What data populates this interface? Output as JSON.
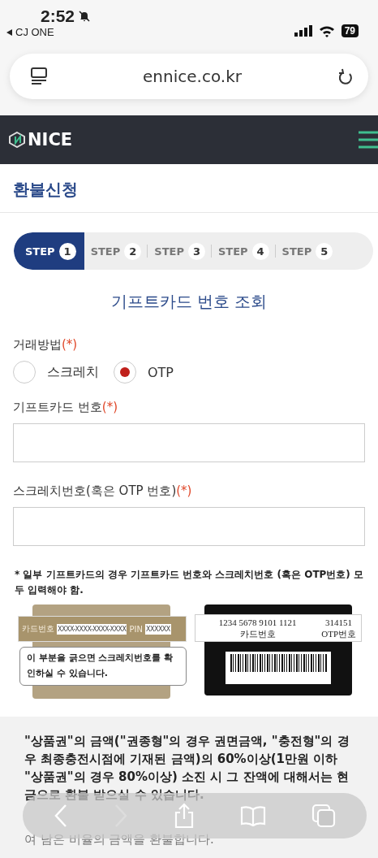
{
  "status_bar": {
    "time": "2:52",
    "back_app": "CJ ONE",
    "battery": "79"
  },
  "address_bar": {
    "url": "ennice.co.kr"
  },
  "site_header": {
    "logo": "NICE"
  },
  "page_title": "환불신청",
  "steps": [
    {
      "label": "STEP",
      "number": "1",
      "selected": true
    },
    {
      "label": "STEP",
      "number": "2",
      "selected": false
    },
    {
      "label": "STEP",
      "number": "3",
      "selected": false
    },
    {
      "label": "STEP",
      "number": "4",
      "selected": false
    },
    {
      "label": "STEP",
      "number": "5",
      "selected": false
    }
  ],
  "section_title": "기프트카드 번호 조회",
  "method": {
    "label": "거래방법",
    "required_mark": "(*)",
    "options": [
      {
        "label": "스크레치",
        "selected": false
      },
      {
        "label": "OTP",
        "selected": true
      }
    ]
  },
  "fields": [
    {
      "label": "기프트카드 번호",
      "required_mark": "(*)"
    },
    {
      "label": "스크레치번호(혹은 OTP 번호)",
      "required_mark": "(*)"
    }
  ],
  "note": "* 일부 기프트카드의 경우 기프트카드 번호와 스크레치번호 (혹은 OTP번호) 모두 입력해야 함.",
  "scratch_card": {
    "card_label": "카드번호",
    "card_value": "XXXX-XXXX-XXXX-XXXX",
    "pin_label": "PIN",
    "pin_value": "XXXXXX",
    "callout": "이 부분을 긁으면 스크레치번호를 확인하실 수 있습니다."
  },
  "otp_card": {
    "card_number": "1234  5678  9101  1121",
    "otp_number": "314151",
    "card_caption": "카드번호",
    "otp_caption": "OTP번호"
  },
  "notice": [
    "\"상품권\"의 금액(\"권종형\"의 경우 권면금액, \"충전형\"의 경우 최종충전시점에 기재된 금액)의 60%이상(1만원 이하 \"상품권\"의 경우 80%이상) 소진 시 그 잔액에 대해서는 현금으로 환불 받으실 수 있습니다.",
    "여 남은 비율의 금액을 환불합니다."
  ]
}
